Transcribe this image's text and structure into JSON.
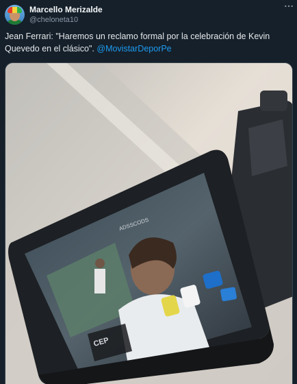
{
  "tweet": {
    "author_name": "Marcello Merizalde",
    "author_handle": "@cheloneta10",
    "text_main": "Jean Ferrari: \"Haremos un reclamo formal por la celebración de Kevin Quevedo en el clásico\". ",
    "mention": "@MovistarDeporPe",
    "more_icon": "more-horizontal-icon"
  },
  "media": {
    "screen_label": "ADSSCODS",
    "caption_fragment": "CEP"
  },
  "colors": {
    "background": "#15202b",
    "text": "#f7f9f9",
    "secondary": "#8b98a5",
    "accent": "#1d9bf0"
  }
}
